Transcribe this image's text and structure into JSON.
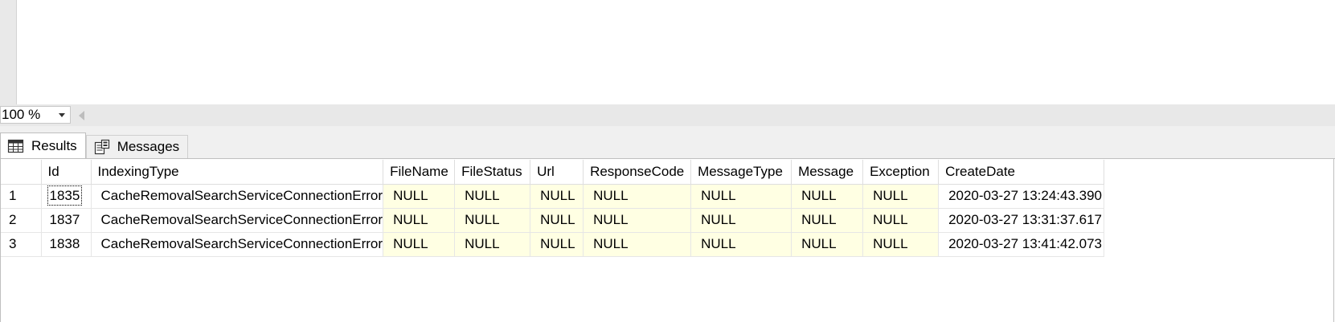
{
  "zoom": {
    "value": "100 %"
  },
  "tabs": [
    {
      "label": "Results",
      "icon": "grid-icon",
      "active": true
    },
    {
      "label": "Messages",
      "icon": "messages-icon",
      "active": false
    }
  ],
  "grid": {
    "columns": [
      "",
      "Id",
      "IndexingType",
      "FileName",
      "FileStatus",
      "Url",
      "ResponseCode",
      "MessageType",
      "Message",
      "Exception",
      "CreateDate"
    ],
    "rows": [
      [
        "1",
        "1835",
        "CacheRemovalSearchServiceConnectionError",
        "NULL",
        "NULL",
        "NULL",
        "NULL",
        "NULL",
        "NULL",
        "NULL",
        "2020-03-27 13:24:43.390"
      ],
      [
        "2",
        "1837",
        "CacheRemovalSearchServiceConnectionError",
        "NULL",
        "NULL",
        "NULL",
        "NULL",
        "NULL",
        "NULL",
        "NULL",
        "2020-03-27 13:31:37.617"
      ],
      [
        "3",
        "1838",
        "CacheRemovalSearchServiceConnectionError",
        "NULL",
        "NULL",
        "NULL",
        "NULL",
        "NULL",
        "NULL",
        "NULL",
        "2020-03-27 13:41:42.073"
      ]
    ]
  },
  "colors": {
    "null_cell_bg": "#ffffe3",
    "panel_bg": "#f0f0f0"
  }
}
